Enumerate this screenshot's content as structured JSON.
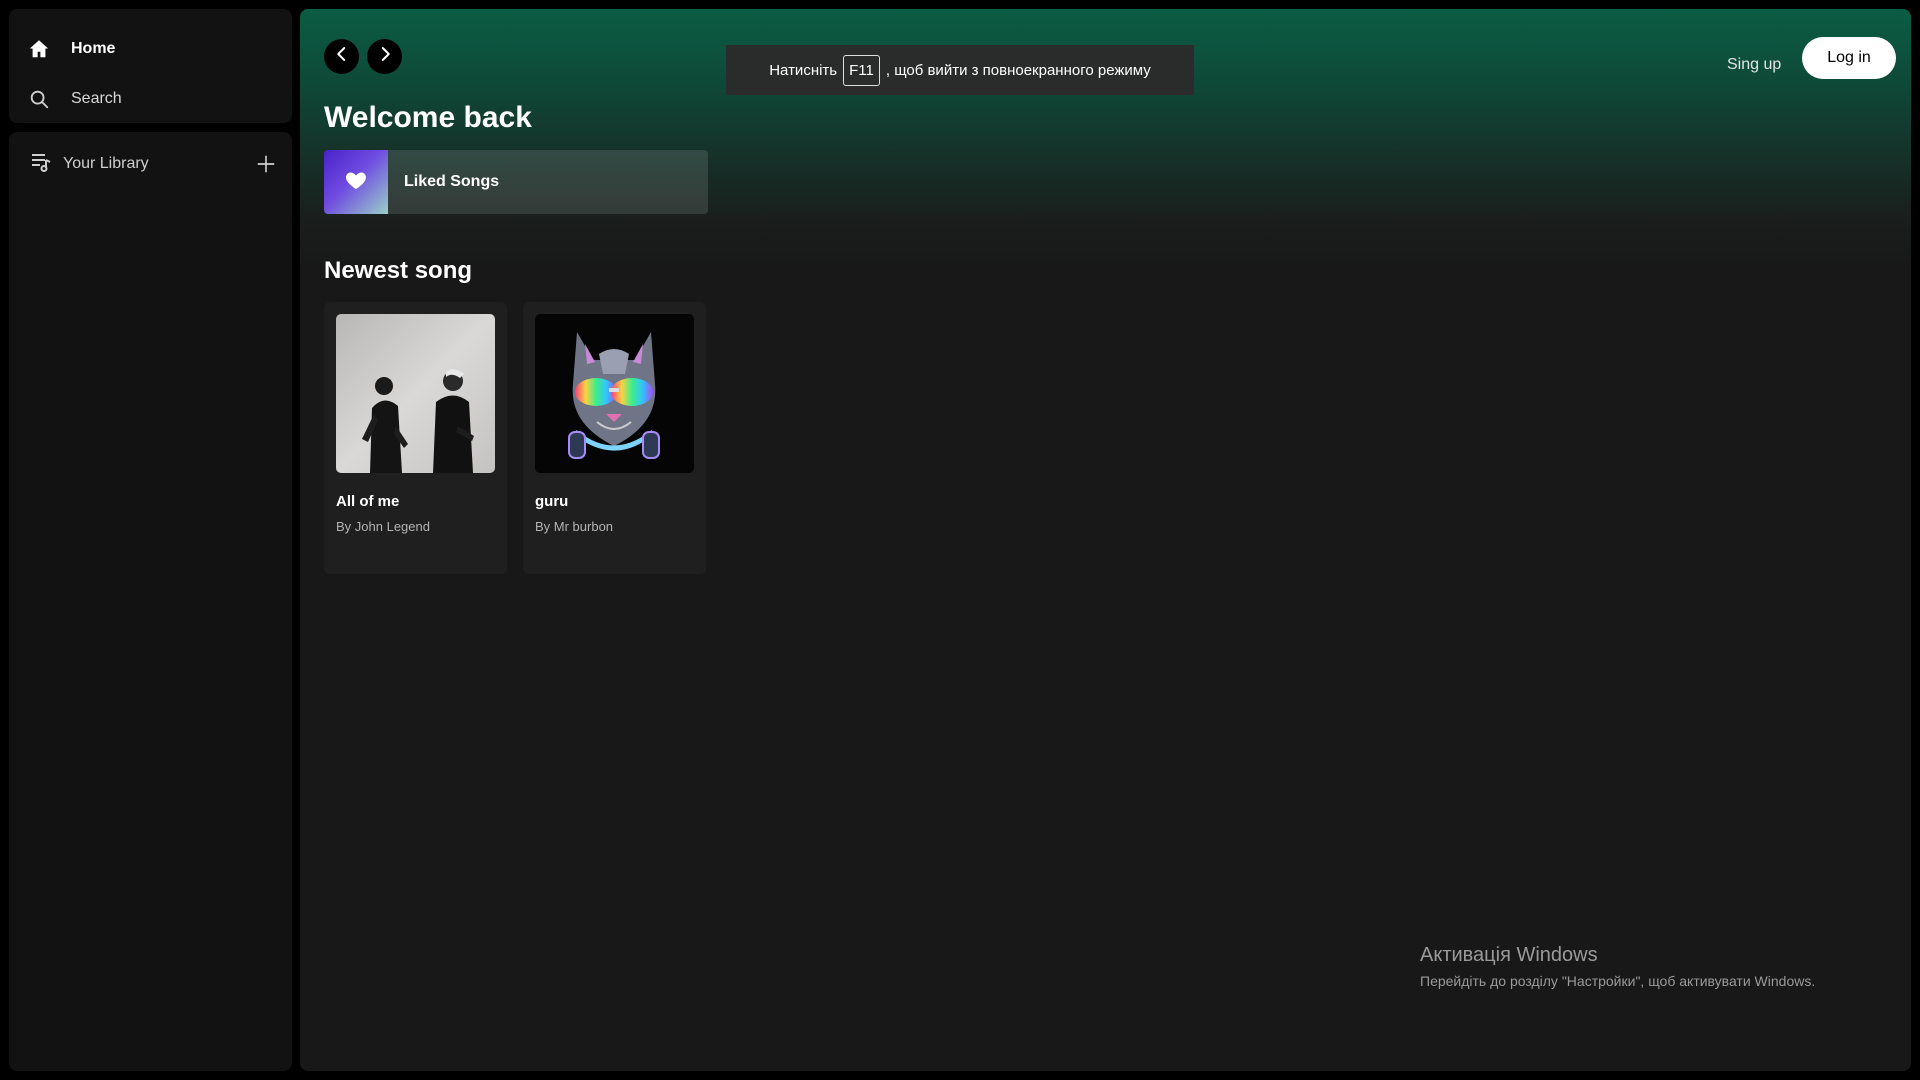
{
  "sidebar": {
    "nav": [
      {
        "label": "Home",
        "icon": "home-icon"
      },
      {
        "label": "Search",
        "icon": "search-icon"
      }
    ],
    "library": {
      "label": "Your Library",
      "icon": "library-icon",
      "add_icon": "plus-icon"
    }
  },
  "header": {
    "back_icon": "chevron-left-icon",
    "forward_icon": "chevron-right-icon",
    "fullscreen_notice": {
      "before": "Натисніть",
      "key": "F11",
      "after": ", щоб вийти з повноекранного режиму"
    },
    "signup_label": "Sing up",
    "login_label": "Log in"
  },
  "main": {
    "welcome": "Welcome back",
    "liked_songs": {
      "label": "Liked Songs",
      "icon": "heart-icon"
    },
    "newest_title": "Newest song",
    "songs": [
      {
        "title": "All of me",
        "artist": "By John Legend"
      },
      {
        "title": "guru",
        "artist": "By Mr burbon"
      }
    ]
  },
  "windows_activation": {
    "title": "Активація Windows",
    "subtitle": "Перейдіть до розділу \"Настройки\", щоб активувати Windows."
  },
  "colors": {
    "accent_green": "#0b5d44",
    "background": "#181818",
    "panel": "#121212"
  }
}
